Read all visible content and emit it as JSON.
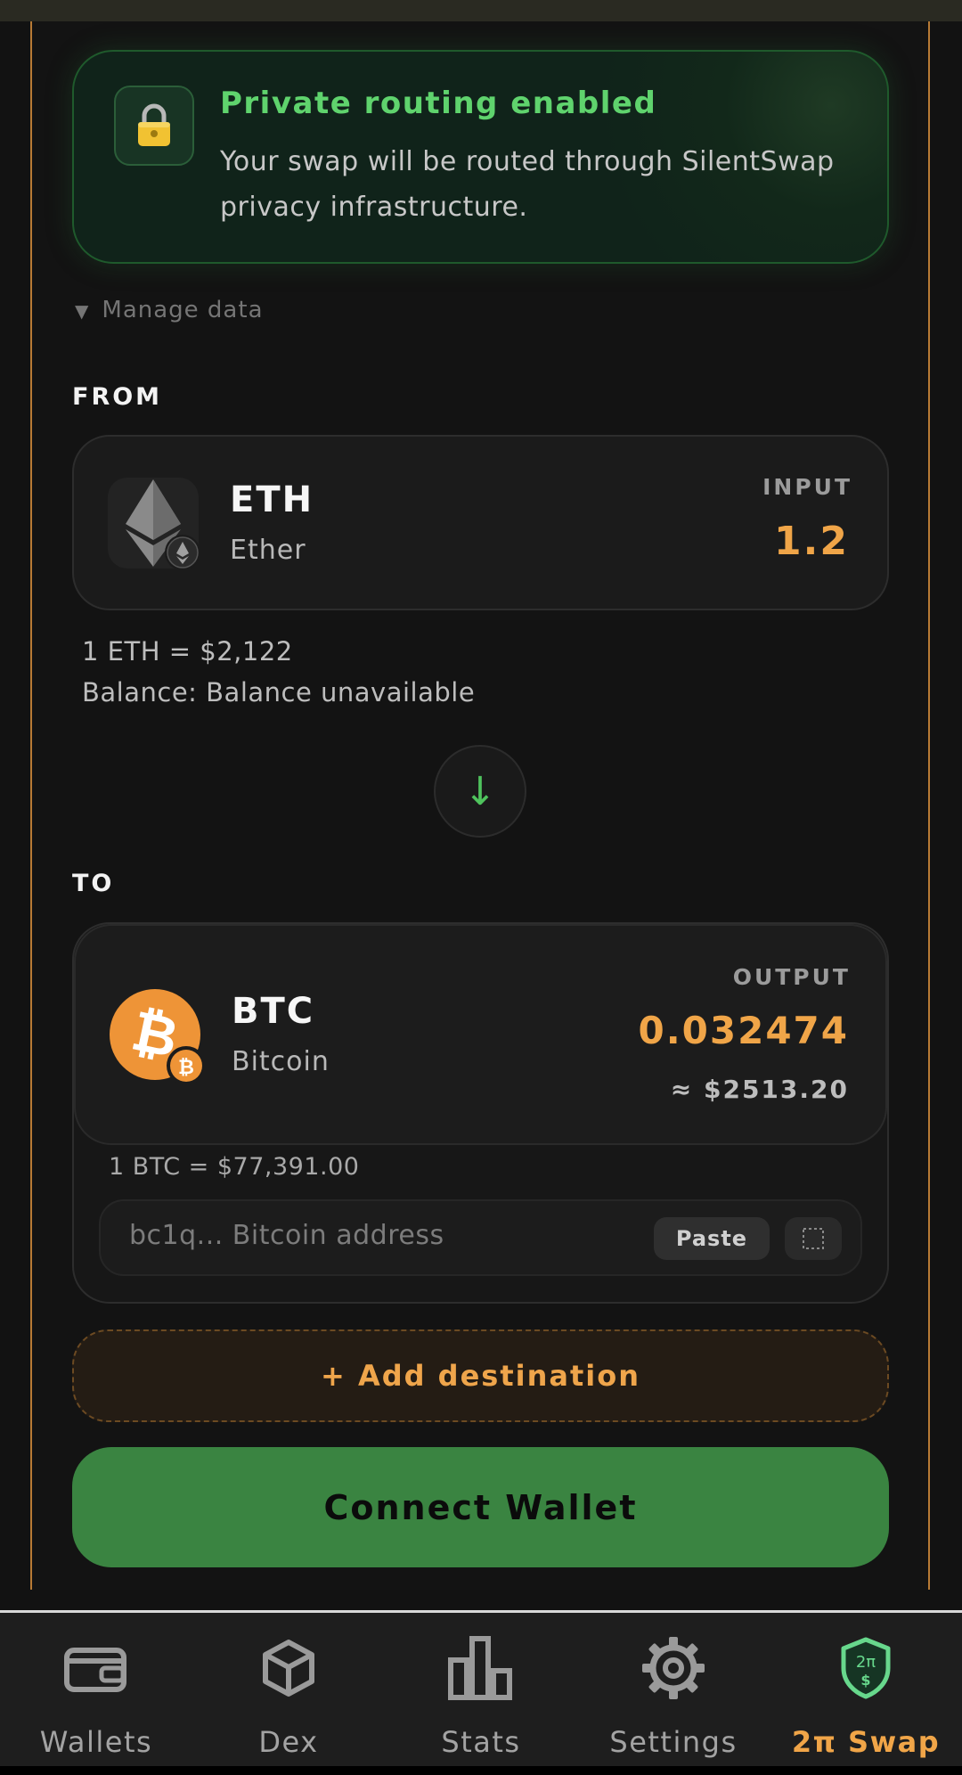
{
  "notice": {
    "title": "Private routing enabled",
    "text": "Your swap will be routed through SilentSwap privacy infrastructure."
  },
  "manage_data": "Manage data",
  "from": {
    "section_label": "FROM",
    "symbol": "ETH",
    "name": "Ether",
    "io_label": "INPUT",
    "amount": "1.2",
    "rate": "1 ETH = $2,122",
    "balance": "Balance: Balance unavailable"
  },
  "swap_direction": "↓",
  "to": {
    "section_label": "TO",
    "symbol": "BTC",
    "name": "Bitcoin",
    "io_label": "OUTPUT",
    "amount": "0.032474",
    "usd_value": "≈ $2513.20",
    "rate": "1 BTC = $77,391.00",
    "address_placeholder": "bc1q... Bitcoin address",
    "paste_label": "Paste"
  },
  "add_destination": "+ Add destination",
  "connect_wallet": "Connect Wallet",
  "nav": {
    "items": [
      {
        "label": "Wallets",
        "icon": "wallet-icon"
      },
      {
        "label": "Dex",
        "icon": "cube-icon"
      },
      {
        "label": "Stats",
        "icon": "bar-chart-icon"
      },
      {
        "label": "Settings",
        "icon": "gear-icon"
      },
      {
        "label": "2π Swap",
        "icon": "shield-swap-icon"
      }
    ],
    "active_index": 4
  },
  "colors": {
    "accent_orange": "#f0a548",
    "accent_green": "#5fd36d",
    "button_green": "#3a8441",
    "panel_border": "#b77a35"
  }
}
